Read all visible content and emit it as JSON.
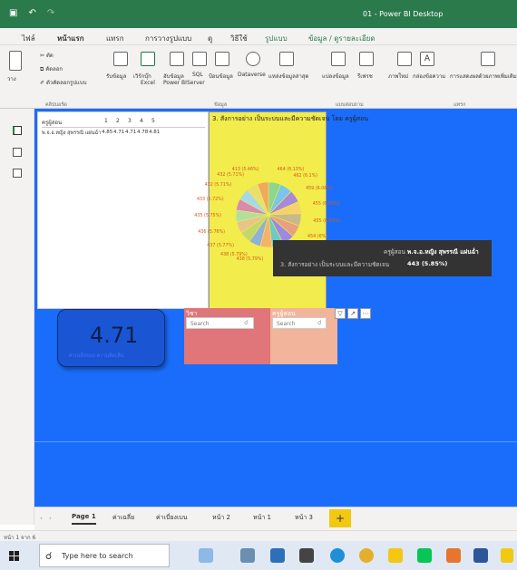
{
  "window": {
    "title": "01 - Power BI Desktop",
    "colors": {
      "titlebar": "#2b7a4b",
      "canvas": "#1a6dfb",
      "pie_card": "#f2ec4c",
      "slicer_red": "#e0757a",
      "slicer_peach": "#f2b49a",
      "kpi": "#1a56d4"
    }
  },
  "ribbon_tabs": [
    "ไฟล์",
    "หน้าแรก",
    "แทรก",
    "การวางรูปแบบ",
    "ดู",
    "วิธีใช้",
    "รูปแบบ",
    "ข้อมูล / ดูรายละเอียด"
  ],
  "ribbon": {
    "paste": "วาง",
    "cut": "ตัด",
    "copy": "คัดลอก",
    "format_painter": "ตัวคัดลอกรูปแบบ",
    "clipboard_label": "คลิปบอร์ด",
    "get_data": "รับข้อมูล",
    "excel_line1": "เวิร์กบุ๊ก",
    "excel_line2": "Excel",
    "datahub_line1": "ฮับข้อมูล",
    "datahub_line2": "Power BI",
    "sql_line1": "SQL",
    "sql_line2": "Server",
    "enter_data": "ป้อนข้อมูล",
    "dataverse": "Dataverse",
    "recent_sources": "แหล่งข้อมูลล่าสุด",
    "data_label": "ข้อมูล",
    "transform": "แปลงข้อมูล",
    "refresh": "รีเฟรช",
    "queries_label": "แบบสอบถาม",
    "visual_new": "ภาพใหม่",
    "textbox": "กล่องข้อความ",
    "more_visuals": "การแสดงผลด้วยภาพเพิ่มเติม",
    "insert_label": "แทรก"
  },
  "table_visual": {
    "headers": [
      "ครูผู้สอน",
      "1",
      "2",
      "3",
      "4",
      "5"
    ],
    "rows": [
      {
        "teacher": "พ.จ.อ.หญิง สุพรรณี แผ่นฉ่ำ",
        "values": [
          "4.85",
          "4.71",
          "4.71",
          "4.78",
          "4.81"
        ]
      }
    ]
  },
  "chart_data": {
    "type": "pie",
    "title": "3. สังการอย่าง เป็นระบบและมีความชัดเจน โดย ครูผู้สอน",
    "slices": [
      {
        "label": "464 (6.13%)",
        "value": 464,
        "color": "#8fd58c"
      },
      {
        "label": "462 (6.1%)",
        "value": 462,
        "color": "#7bc4ec"
      },
      {
        "label": "459 (6.06%)",
        "value": 459,
        "color": "#a888d8"
      },
      {
        "label": "455 (6.01%)",
        "value": 455,
        "color": "#f5d36a"
      },
      {
        "label": "455 (6.01%)",
        "value": 455,
        "color": "#c9b98a"
      },
      {
        "label": "454 (6%)",
        "value": 454,
        "color": "#e8a080"
      },
      {
        "label": "443 (5.85%)",
        "value": 443,
        "color": "#9a8ae2"
      },
      {
        "label": "443 (5.85%)",
        "value": 443,
        "color": "#6fc9c7"
      },
      {
        "label": "438 (5.79%)",
        "value": 438,
        "color": "#f5b36a"
      },
      {
        "label": "438 (5.79%)",
        "value": 438,
        "color": "#8fb0d8"
      },
      {
        "label": "437 (5.77%)",
        "value": 437,
        "color": "#c2d86a"
      },
      {
        "label": "436 (5.76%)",
        "value": 436,
        "color": "#e8c48a"
      },
      {
        "label": "435 (5.75%)",
        "value": 435,
        "color": "#b0e0a0"
      },
      {
        "label": "433 (5.72%)",
        "value": 433,
        "color": "#d88ab0"
      },
      {
        "label": "432 (5.71%)",
        "value": 432,
        "color": "#a5d8e8"
      },
      {
        "label": "432 (5.71%)",
        "value": 432,
        "color": "#e8e06a"
      },
      {
        "label": "413 (5.46%)",
        "value": 413,
        "color": "#f0a860"
      }
    ]
  },
  "tooltip": {
    "key1": "ครูผู้สอน",
    "val1": "พ.จ.อ.หญิง สุพรรณี แผ่นฉ่ำ",
    "key2": "3. สังการอย่าง เป็นระบบและมีความชัดเจน",
    "val2": "443 (5.85%)"
  },
  "kpi": {
    "value": "4.71",
    "caption": "ค่าเฉลี่ยของ ความคิดเห็น"
  },
  "slicers": [
    {
      "title": "วิชา",
      "placeholder": "Search"
    },
    {
      "title": "ครูผู้สอน",
      "placeholder": "Search"
    }
  ],
  "pages": [
    "Page 1",
    "ค่าเฉลี่ย",
    "ค่าเบี่ยงเบน",
    "หน้า 2",
    "หน้า 1",
    "หน้า 3"
  ],
  "add_page": "+",
  "status": "หน้า 1 จาก 6",
  "taskbar": {
    "search_placeholder": "Type here to search"
  }
}
